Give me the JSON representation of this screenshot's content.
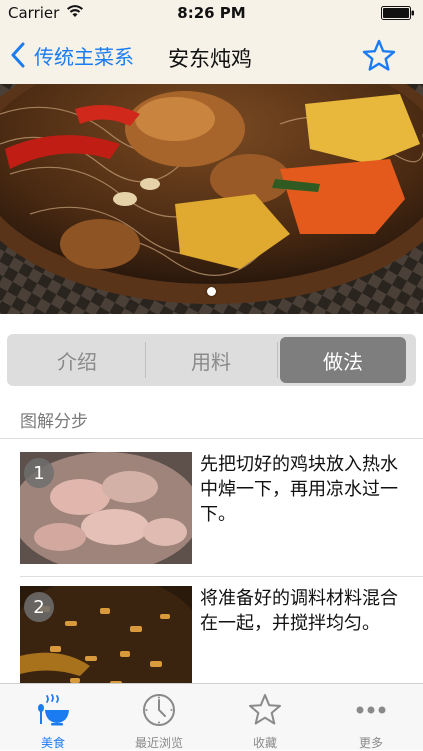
{
  "status_bar": {
    "carrier": "Carrier",
    "time": "8:26 PM"
  },
  "nav": {
    "back_label": "传统主菜系",
    "title": "安东炖鸡"
  },
  "segments": [
    "介绍",
    "用料",
    "做法"
  ],
  "selected_segment": "做法",
  "section_header": "图解分步",
  "steps": [
    {
      "number": "1",
      "text": "先把切好的鸡块放入热水中焯一下，再用凉水过一下。"
    },
    {
      "number": "2",
      "text": "将准备好的调料材料混合在一起，并搅拌均匀。"
    }
  ],
  "tabs": [
    {
      "label": "美食",
      "icon": "food-bowl-icon",
      "active": true
    },
    {
      "label": "最近浏览",
      "icon": "clock-icon",
      "active": false
    },
    {
      "label": "收藏",
      "icon": "star-icon",
      "active": false
    },
    {
      "label": "更多",
      "icon": "more-dots-icon",
      "active": false
    }
  ],
  "colors": {
    "accent": "#1b7cf2",
    "nav_background": "#f7f2e8",
    "segment_selected": "#7e7e7e"
  }
}
